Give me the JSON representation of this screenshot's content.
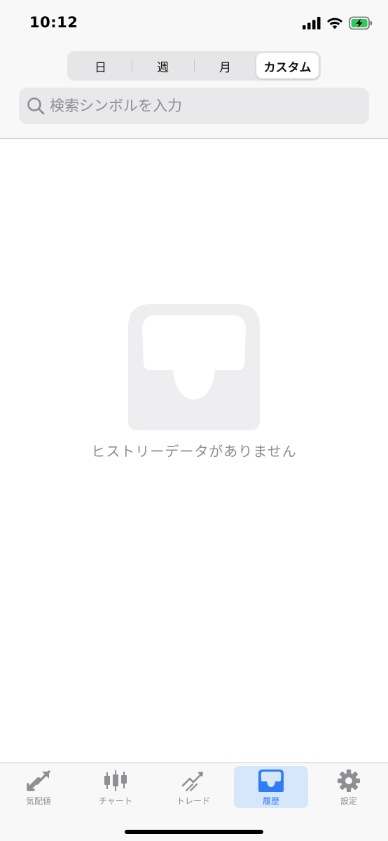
{
  "status_bar": {
    "time": "10:12"
  },
  "segments": [
    {
      "label": "日",
      "active": false
    },
    {
      "label": "週",
      "active": false
    },
    {
      "label": "月",
      "active": false
    },
    {
      "label": "カスタム",
      "active": true
    }
  ],
  "search": {
    "placeholder": "検索シンボルを入力",
    "value": ""
  },
  "empty_state": {
    "message": "ヒストリーデータがありません",
    "icon": "inbox-icon"
  },
  "tabbar": {
    "items": [
      {
        "label": "気配値",
        "icon": "quote-arrows-icon",
        "active": false
      },
      {
        "label": "チャート",
        "icon": "candlestick-icon",
        "active": false
      },
      {
        "label": "トレード",
        "icon": "trade-trend-icon",
        "active": false
      },
      {
        "label": "履歴",
        "icon": "inbox-icon",
        "active": true
      },
      {
        "label": "設定",
        "icon": "gear-icon",
        "active": false
      }
    ]
  },
  "colors": {
    "accent": "#2f7cf6",
    "active_tab_bg": "#d6e6fb",
    "inactive": "#8e8e93",
    "empty_icon": "#eeeef0"
  }
}
